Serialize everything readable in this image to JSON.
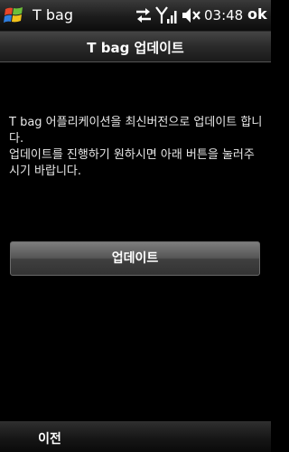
{
  "status_bar": {
    "app_title": "T bag",
    "time": "03:48",
    "ok_label": "ok",
    "icons": [
      "windows-start-icon",
      "data-sync-icon",
      "signal-strength-icon",
      "volume-muted-icon"
    ]
  },
  "header": {
    "title": "T bag 업데이트"
  },
  "message": {
    "line1": "T bag 어플리케이션을 최신버전으로 업데이트 합니다.",
    "line2": "업데이트를 진행하기 원하시면 아래 버튼을 눌러주시기 바랍니다."
  },
  "update_button": {
    "label": "업데이트"
  },
  "soft_keys": {
    "left_label": "이전"
  },
  "colors": {
    "background": "#000000",
    "text": "#ffffff",
    "button_top": "#7d7d7d",
    "button_bottom": "#333333"
  }
}
